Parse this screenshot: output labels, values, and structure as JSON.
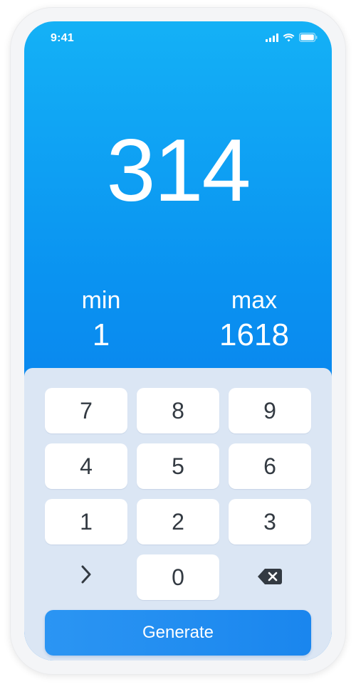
{
  "status_bar": {
    "time": "9:41",
    "icons": [
      "cellular-signal-icon",
      "wifi-icon",
      "battery-icon"
    ]
  },
  "result": {
    "value": "314"
  },
  "range": {
    "min_label": "min",
    "min_value": "1",
    "max_label": "max",
    "max_value": "1618"
  },
  "keypad": {
    "keys": [
      "7",
      "8",
      "9",
      "4",
      "5",
      "6",
      "1",
      "2",
      "3",
      "0"
    ],
    "next_icon": "chevron-right-icon",
    "delete_icon": "backspace-icon"
  },
  "generate": {
    "label": "Generate"
  },
  "colors": {
    "accent": "#0a93f1",
    "keypad_background": "#dbe6f4",
    "key_background": "#ffffff",
    "key_text": "#333a42"
  }
}
